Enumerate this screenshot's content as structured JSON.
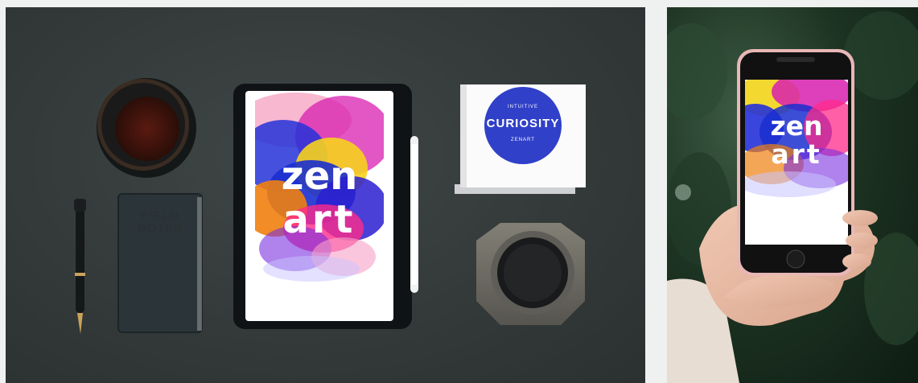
{
  "tablet": {
    "line1": "zen",
    "line2": "art"
  },
  "phone": {
    "line1": "zen",
    "line2": "art"
  },
  "cube": {
    "top": "INTUITIVE",
    "main": "CURIOSITY",
    "bottom": "ZENART"
  },
  "notebook": {
    "line1": "FIELD",
    "line2": "NOTES"
  },
  "colors": {
    "logo_blue": "#3040c8",
    "desk": "#343a3a",
    "foliage": "#1d3322",
    "page_bg": "#eef1ef"
  }
}
